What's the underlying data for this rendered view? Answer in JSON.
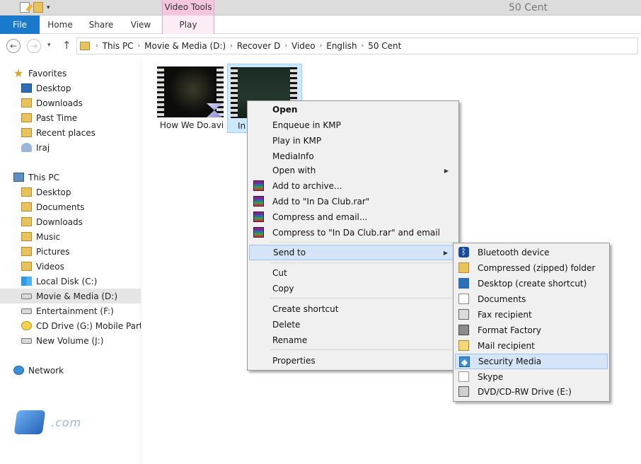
{
  "window": {
    "title": "50 Cent",
    "context_tab_header": "Video Tools"
  },
  "ribbon": {
    "tabs": [
      "File",
      "Home",
      "Share",
      "View",
      "Play"
    ]
  },
  "address": {
    "breadcrumbs": [
      "This PC",
      "Movie & Media (D:)",
      "Recover D",
      "Video",
      "English",
      "50 Cent"
    ]
  },
  "navpane": {
    "favorites_header": "Favorites",
    "favorites": [
      "Desktop",
      "Downloads",
      "Past Time",
      "Recent places",
      "Iraj"
    ],
    "thispc_header": "This PC",
    "thispc": [
      "Desktop",
      "Documents",
      "Downloads",
      "Music",
      "Pictures",
      "Videos",
      "Local Disk (C:)",
      "Movie & Media (D:)",
      "Entertainment (F:)",
      "CD Drive (G:) Mobile Partner",
      "New Volume (J:)"
    ],
    "network_header": "Network",
    "selected": "Movie & Media (D:)"
  },
  "files": [
    {
      "name": "How We Do.avi"
    },
    {
      "name": "In"
    }
  ],
  "context_menu": {
    "items": [
      {
        "label": "Open",
        "bold": true
      },
      {
        "label": "Enqueue in KMP"
      },
      {
        "label": "Play in KMP"
      },
      {
        "label": "MediaInfo"
      },
      {
        "label": "Open with",
        "submenu": true
      },
      {
        "label": "Add to archive...",
        "icon": "winrar-icon"
      },
      {
        "label": "Add to \"In Da Club.rar\"",
        "icon": "winrar-icon"
      },
      {
        "label": "Compress and email...",
        "icon": "winrar-icon"
      },
      {
        "label": "Compress to \"In Da Club.rar\" and email",
        "icon": "winrar-icon"
      },
      {
        "label": "Send to",
        "submenu": true,
        "highlighted": true
      },
      {
        "label": "Cut"
      },
      {
        "label": "Copy"
      },
      {
        "label": "Create shortcut"
      },
      {
        "label": "Delete"
      },
      {
        "label": "Rename"
      },
      {
        "label": "Properties"
      }
    ]
  },
  "sendto_menu": {
    "items": [
      {
        "label": "Bluetooth device",
        "icon": "bluetooth-icon"
      },
      {
        "label": "Compressed (zipped) folder",
        "icon": "zip-folder-icon"
      },
      {
        "label": "Desktop (create shortcut)",
        "icon": "desktop-icon"
      },
      {
        "label": "Documents",
        "icon": "documents-icon"
      },
      {
        "label": "Fax recipient",
        "icon": "fax-icon"
      },
      {
        "label": "Format Factory",
        "icon": "format-factory-icon"
      },
      {
        "label": "Mail recipient",
        "icon": "mail-icon"
      },
      {
        "label": "Security Media",
        "icon": "security-media-icon",
        "highlighted": true
      },
      {
        "label": "Skype",
        "icon": "skype-icon"
      },
      {
        "label": "DVD/CD-RW Drive (E:)",
        "icon": "dvd-drive-icon"
      }
    ]
  },
  "watermark": {
    "text": ".com"
  }
}
